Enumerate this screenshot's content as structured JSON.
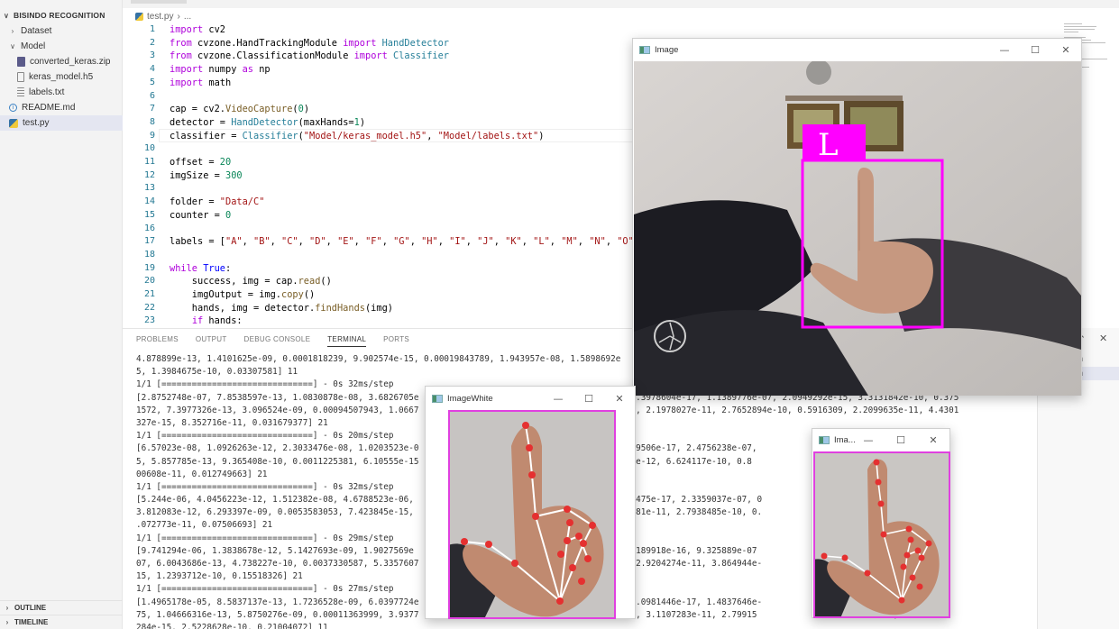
{
  "sidebar": {
    "title": "BISINDO RECOGNITION",
    "items": [
      {
        "label": "Dataset",
        "type": "folder-collapsed"
      },
      {
        "label": "Model",
        "type": "folder-open"
      },
      {
        "label": "converted_keras.zip",
        "type": "zip"
      },
      {
        "label": "keras_model.h5",
        "type": "file"
      },
      {
        "label": "labels.txt",
        "type": "text"
      },
      {
        "label": "README.md",
        "type": "info"
      },
      {
        "label": "test.py",
        "type": "python",
        "active": true
      }
    ],
    "outline": "OUTLINE",
    "timeline": "TIMELINE"
  },
  "breadcrumb": {
    "file": "test.py",
    "rest": "..."
  },
  "editor": {
    "lines": [
      "1",
      "2",
      "3",
      "4",
      "5",
      "6",
      "7",
      "8",
      "9",
      "10",
      "11",
      "12",
      "13",
      "14",
      "15",
      "16",
      "17",
      "18",
      "19",
      "20",
      "21",
      "22",
      "23"
    ]
  },
  "panel": {
    "tabs": [
      "PROBLEMS",
      "OUTPUT",
      "DEBUG CONSOLE",
      "TERMINAL",
      "PORTS"
    ],
    "active_tab": "TERMINAL",
    "side_items": [
      "on",
      "on"
    ],
    "terminal_lines": [
      "4.878899e-13, 1.4101625e-09, 0.0001818239, 9.902574e-15, 0.00019843789, 1.943957e-08, 1.5898692e",
      "5, 1.3984675e-10, 0.03307581] 11",
      "1/1 [==============================] - 0s 32ms/step",
      "[2.8752748e-07, 7.8538597e-13, 1.0830878e-08, 3.6826705e                                    e-21, 1.3978604e-17, 1.1389776e-07, 2.0949292e-15, 3.3131842e-10, 0.375",
      "1572, 7.3977326e-13, 3.096524e-09, 0.00094507943, 1.0667                                 438814e-15, 2.1978027e-11, 2.7652894e-10, 0.5916309, 2.2099635e-11, 4.4301",
      "327e-15, 8.352716e-11, 0.031679377] 21",
      "1/1 [==============================] - 0s 20ms/step",
      "[6.57023e-08, 1.0926263e-12, 2.3033476e-08, 1.0203523e-0                                 e-21, 1.579506e-17, 2.4756238e-07,                      16, 0.11710007",
      "5, 5.857785e-13, 9.365408e-10, 0.0011225381, 6.10555e-15                                 5, 1.88144e-12, 6.624117e-10, 0.8                         101e-15, 4.21",
      "00608e-11, 0.012749663] 21",
      "1/1 [==============================] - 0s 32ms/step",
      "[5.244e-06, 4.0456223e-12, 1.512382e-08, 4.6788523e-06,                                   0, 6.4628475e-17, 2.3359037e-07, 0              , 0.20466064,",
      "3.812083e-12, 6.293397e-09, 0.0053583053, 7.423845e-15,                                   , 1.1703181e-11, 2.7938485e-10, 0.             6443295e-15, 7",
      ".072773e-11, 0.07506693] 21",
      "1/1 [==============================] - 0s 29ms/step",
      "[9.741294e-06, 1.3838678e-12, 5.1427693e-09, 1.9027569e                                  6e-22, 1.0189918e-16, 9.325889e-07                    e-16, 0.247230",
      "07, 6.0043686e-13, 4.738227e-10, 0.0037330587, 5.3357607                                  665e-14, 2.9204274e-11, 3.864944e-                    9, 2.4413512e-",
      "15, 1.2393712e-10, 0.15518326] 21",
      "1/1 [==============================] - 0s 27ms/step",
      "[1.4965178e-05, 8.5837137e-13, 1.7236528e-09, 6.0397724e                                  21e-21, 4.0981446e-17, 1.4837646e-                    e-15, 0.735284",
      "75, 1.04666316e-13, 5.8750276e-09, 0.00011363999, 3.9377                                  94301e-14, 3.1107283e-11, 2.79915                     83e-09, 5.2111",
      "284e-15, 2.5228628e-10, 0.21004072] 11"
    ]
  },
  "windows": {
    "image": {
      "title": "Image",
      "overlay_letter": "L"
    },
    "image_white": {
      "title": "ImageWhite"
    },
    "image_crop": {
      "title": "Ima..."
    },
    "controls": {
      "minimize": "—",
      "maximize": "☐",
      "close": "✕"
    }
  },
  "colors": {
    "bbox": "#ff00ff",
    "landmark": "#e53030",
    "editor_keyword": "#0000ff",
    "editor_string": "#a31515"
  }
}
